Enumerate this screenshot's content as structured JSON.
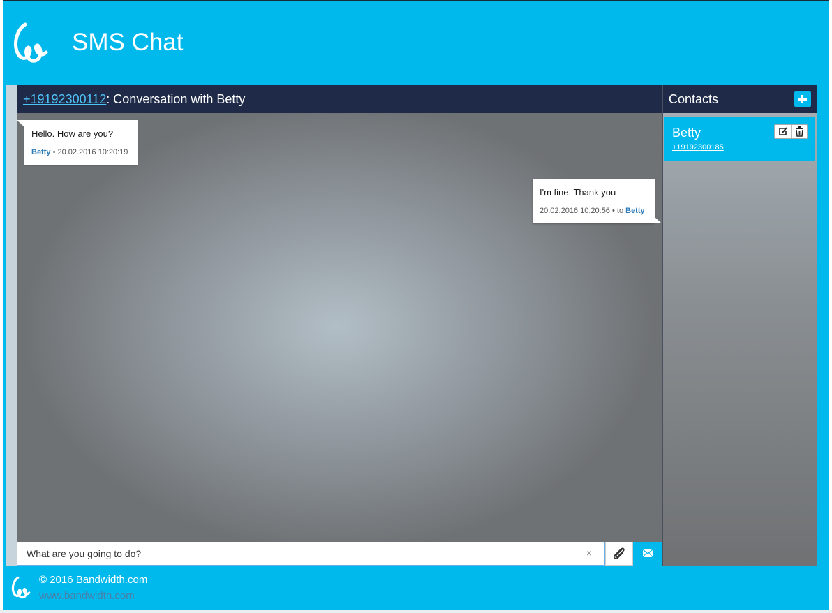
{
  "app": {
    "title": "SMS Chat"
  },
  "conversation": {
    "phone": "+19192300112",
    "title_suffix": ": Conversation with Betty",
    "messages": [
      {
        "direction": "incoming",
        "text": "Hello. How are you?",
        "sender": "Betty",
        "meta": " • 20.02.2016 10:20:19"
      },
      {
        "direction": "outgoing",
        "text": "I'm fine. Thank you",
        "meta": "20.02.2016 10:20:56 • to ",
        "recipient": "Betty"
      }
    ],
    "input_value": "What are you going to do?",
    "clear_glyph": "×"
  },
  "contacts": {
    "title": "Contacts",
    "items": [
      {
        "name": "Betty",
        "phone": "+19192300185",
        "selected": true
      }
    ]
  },
  "footer": {
    "copyright": "© 2016 Bandwidth.com",
    "website": "www.bandwidth.com"
  },
  "colors": {
    "brand": "#00b9ec",
    "header_bar": "#1e2a47",
    "link": "#4ec3f5",
    "sender_name": "#2a7ab8"
  },
  "icons": {
    "logo": "bandwidth-logo-icon",
    "add_contact": "plus-icon",
    "edit": "edit-icon",
    "delete": "trash-icon",
    "attach": "paperclip-icon",
    "send": "envelope-icon",
    "clear": "close-icon"
  }
}
